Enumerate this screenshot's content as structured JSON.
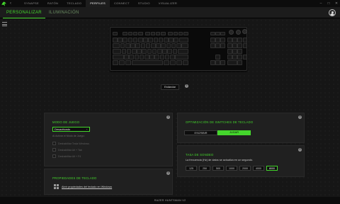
{
  "main_tabs": [
    "SYNAPSE",
    "RATÓN",
    "TECLADO",
    "PERFILES",
    "CONNECT",
    "STUDIO",
    "VISUALIZER"
  ],
  "active_main_tab": "PERFILES",
  "sub_tabs": [
    "PERSONALIZAR",
    "ILUMINACIÓN"
  ],
  "profile": {
    "selected": "Estándar"
  },
  "game_mode": {
    "title": "MODO DE JUEGO",
    "dropdown_value": "Desactivado",
    "hint": "Al Activar el Modo de Juego:",
    "options": [
      "Deshabilitar Tecla Windows",
      "Deshabilitar Alt + Tab",
      "Deshabilitar Alt + F4"
    ]
  },
  "keyboard_props": {
    "title": "PROPIEDADES DE TECLADO",
    "link": "Abrir propiedades del teclado en Windows"
  },
  "switch_opt": {
    "title": "OPTIMIZACIÓN DE SWITCHES DE TECLADO",
    "options": [
      "ESCRIBIR",
      "JUGAR"
    ],
    "selected": "JUGAR"
  },
  "polling": {
    "title": "TASA DE SONDEO",
    "description": "La frecuencia (Hz) de datos se actualiza en un segundo.",
    "rates": [
      "125",
      "250",
      "500",
      "1000",
      "2000",
      "4000",
      "8000"
    ],
    "selected": "8000"
  },
  "device_name": "RAZER HUNTSMAN V2",
  "colors": {
    "accent": "#44d62c",
    "background": "#161616",
    "panel": "#202020"
  },
  "icons": [
    "razer-logo-icon",
    "back-arrow-icon",
    "minimize-icon",
    "maximize-icon",
    "close-icon",
    "user-avatar-icon",
    "menu-icon",
    "help-icon",
    "windows-icon"
  ]
}
